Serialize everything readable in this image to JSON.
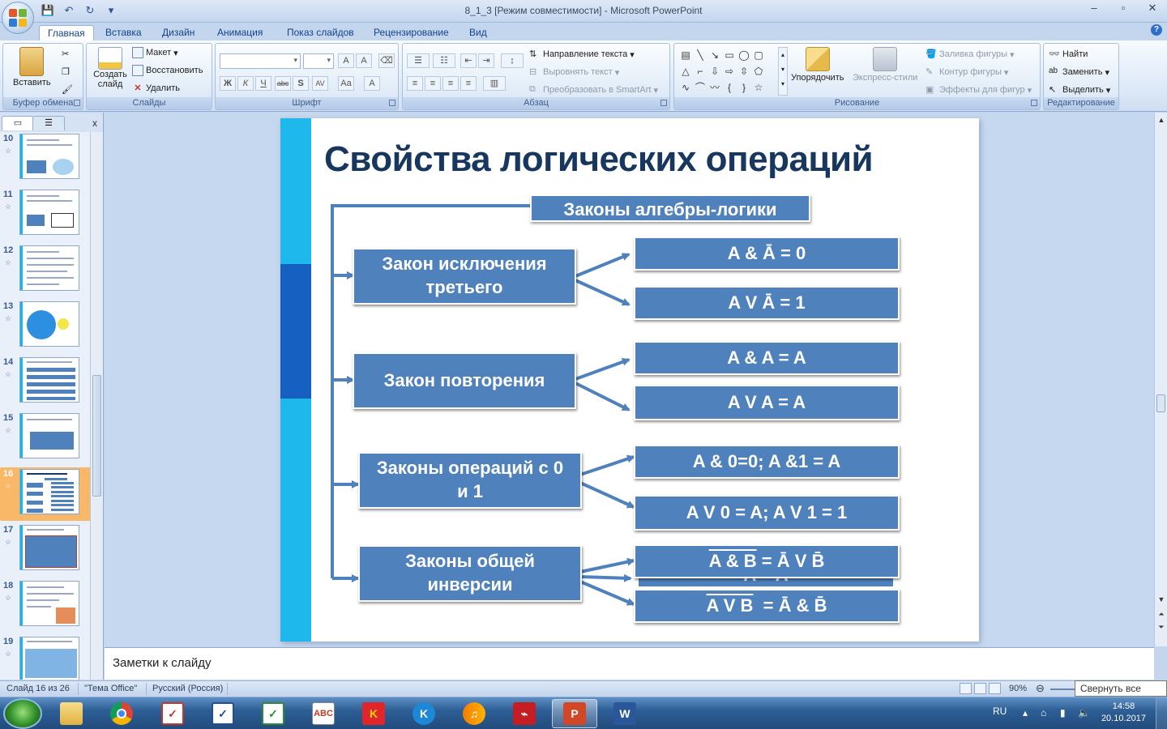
{
  "window": {
    "title": "8_1_3 [Режим совместимости] - Microsoft PowerPoint",
    "controls": [
      "–",
      "▫",
      "✕"
    ]
  },
  "ribbon": {
    "tabs": [
      "Главная",
      "Вставка",
      "Дизайн",
      "Анимация",
      "Показ слайдов",
      "Рецензирование",
      "Вид"
    ],
    "active_tab": "Главная",
    "groups": {
      "clipboard": {
        "label": "Буфер обмена",
        "paste": "Вставить"
      },
      "slides": {
        "label": "Слайды",
        "new_slide": "Создать слайд",
        "layout": "Макет",
        "reset": "Восстановить",
        "delete": "Удалить"
      },
      "font": {
        "label": "Шрифт"
      },
      "paragraph": {
        "label": "Абзац",
        "text_direction": "Направление текста",
        "align_text": "Выровнять текст",
        "smartart": "Преобразовать в SmartArt"
      },
      "drawing": {
        "label": "Рисование",
        "arrange": "Упорядочить",
        "quick_styles": "Экспресс-стили",
        "shape_fill": "Заливка фигуры",
        "shape_outline": "Контур фигуры",
        "shape_effects": "Эффекты для фигур"
      },
      "editing": {
        "label": "Редактирование",
        "find": "Найти",
        "replace": "Заменить",
        "select": "Выделить"
      }
    }
  },
  "slide_panel": {
    "thumbnails": [
      {
        "num": "10"
      },
      {
        "num": "11"
      },
      {
        "num": "12"
      },
      {
        "num": "13"
      },
      {
        "num": "14"
      },
      {
        "num": "15"
      },
      {
        "num": "16"
      },
      {
        "num": "17"
      },
      {
        "num": "18"
      },
      {
        "num": "19"
      }
    ],
    "selected": "16"
  },
  "slide": {
    "title": "Свойства логических операций",
    "header": "Законы алгебры-логики",
    "laws": [
      {
        "name": "Закон исключения третьего",
        "formula1": "A & Ā = 0",
        "formula2": "A V Ā = 1"
      },
      {
        "name": "Закон повторения",
        "formula1": "A & A = A",
        "formula2": "A V A = A"
      },
      {
        "name": "Законы операций с 0 и 1",
        "formula1": "A & 0=0;   A &1 = A",
        "formula2": "A V 0 = A;  A V 1 = 1"
      },
      {
        "name": "Законы общей инверсии",
        "formula1_over": "A & B",
        "formula1_rest": " = Ā V B̄",
        "formula2_over": "A V B",
        "formula2_rest": "  = Ā & B̄"
      }
    ],
    "hidden_text": "A = A"
  },
  "notes": {
    "placeholder": "Заметки к слайду"
  },
  "status": {
    "slide_info": "Слайд 16 из 26",
    "theme": "\"Тема Office\"",
    "language": "Русский (Россия)",
    "zoom": "90%",
    "tooltip": "Свернуть все окна"
  },
  "taskbar": {
    "lang": "RU",
    "time": "14:58",
    "date": "20.10.2017"
  },
  "colors": {
    "box_blue": "#4f81bd",
    "title_navy": "#17375e",
    "side_cyan": "#1fb8ec",
    "side_dark": "#1560c1"
  }
}
